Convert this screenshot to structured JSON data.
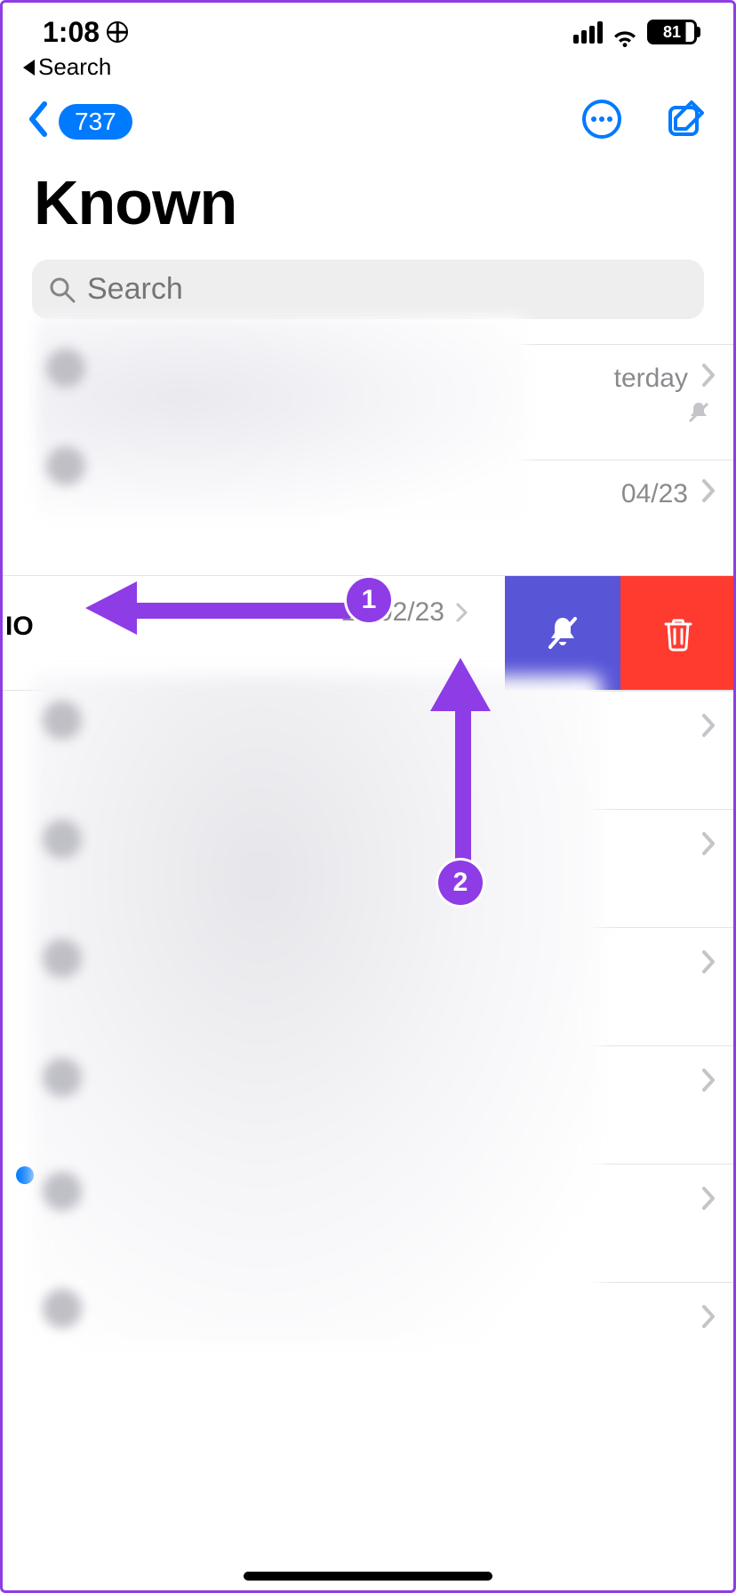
{
  "status": {
    "time": "1:08",
    "battery_pct": "81"
  },
  "back_app": {
    "label": "Search"
  },
  "nav": {
    "badge": "737"
  },
  "title": "Known",
  "search": {
    "placeholder": "Search"
  },
  "rows": {
    "r1_date": "terday",
    "r2_date": "04/23",
    "swiped_label": "IO",
    "swiped_date": "16/02/23"
  },
  "annotations": {
    "step1": "1",
    "step2": "2"
  }
}
